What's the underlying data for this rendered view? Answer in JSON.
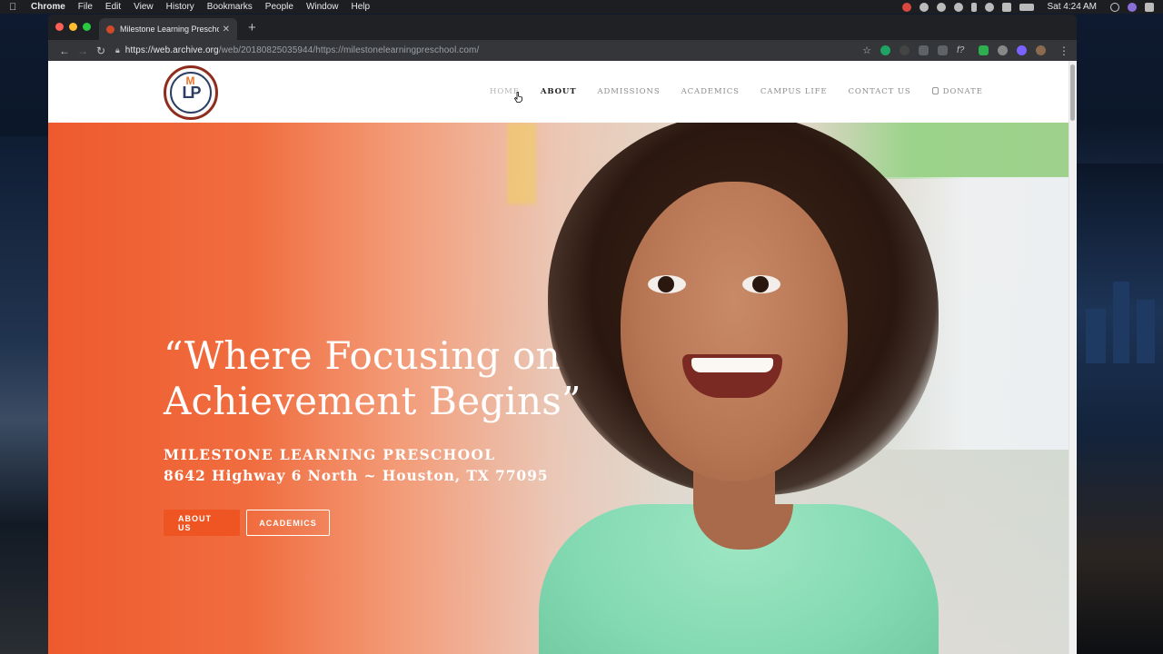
{
  "menubar": {
    "app": "Chrome",
    "items": [
      "File",
      "Edit",
      "View",
      "History",
      "Bookmarks",
      "People",
      "Window",
      "Help"
    ],
    "clock": "Sat 4:24 AM"
  },
  "browser": {
    "tab_title": "Milestone Learning Preschool | ",
    "url_host": "https://web.archive.org",
    "url_rest": "/web/20180825035944/https://milestonelearningpreschool.com/"
  },
  "site": {
    "nav": [
      {
        "label": "HOME",
        "state": "hover"
      },
      {
        "label": "ABOUT",
        "state": "active"
      },
      {
        "label": "ADMISSIONS",
        "state": "normal"
      },
      {
        "label": "ACADEMICS",
        "state": "normal"
      },
      {
        "label": "CAMPUS LIFE",
        "state": "normal"
      },
      {
        "label": "CONTACT US",
        "state": "normal"
      },
      {
        "label": "DONATE",
        "state": "normal"
      }
    ],
    "logo_letters": "LP",
    "logo_m": "M"
  },
  "hero": {
    "quote_line1": "“Where Focusing on",
    "quote_line2": "Achievement Begins”",
    "school_name": "MILESTONE LEARNING PRESCHOOL",
    "address": "8642 Highway 6 North ~ Houston, TX 77095",
    "buttons": {
      "about": "ABOUT US",
      "academics": "ACADEMICS"
    }
  },
  "colors": {
    "accent": "#ee5522",
    "brand_navy": "#2c3e63",
    "brand_maroon": "#8e2d1e"
  }
}
